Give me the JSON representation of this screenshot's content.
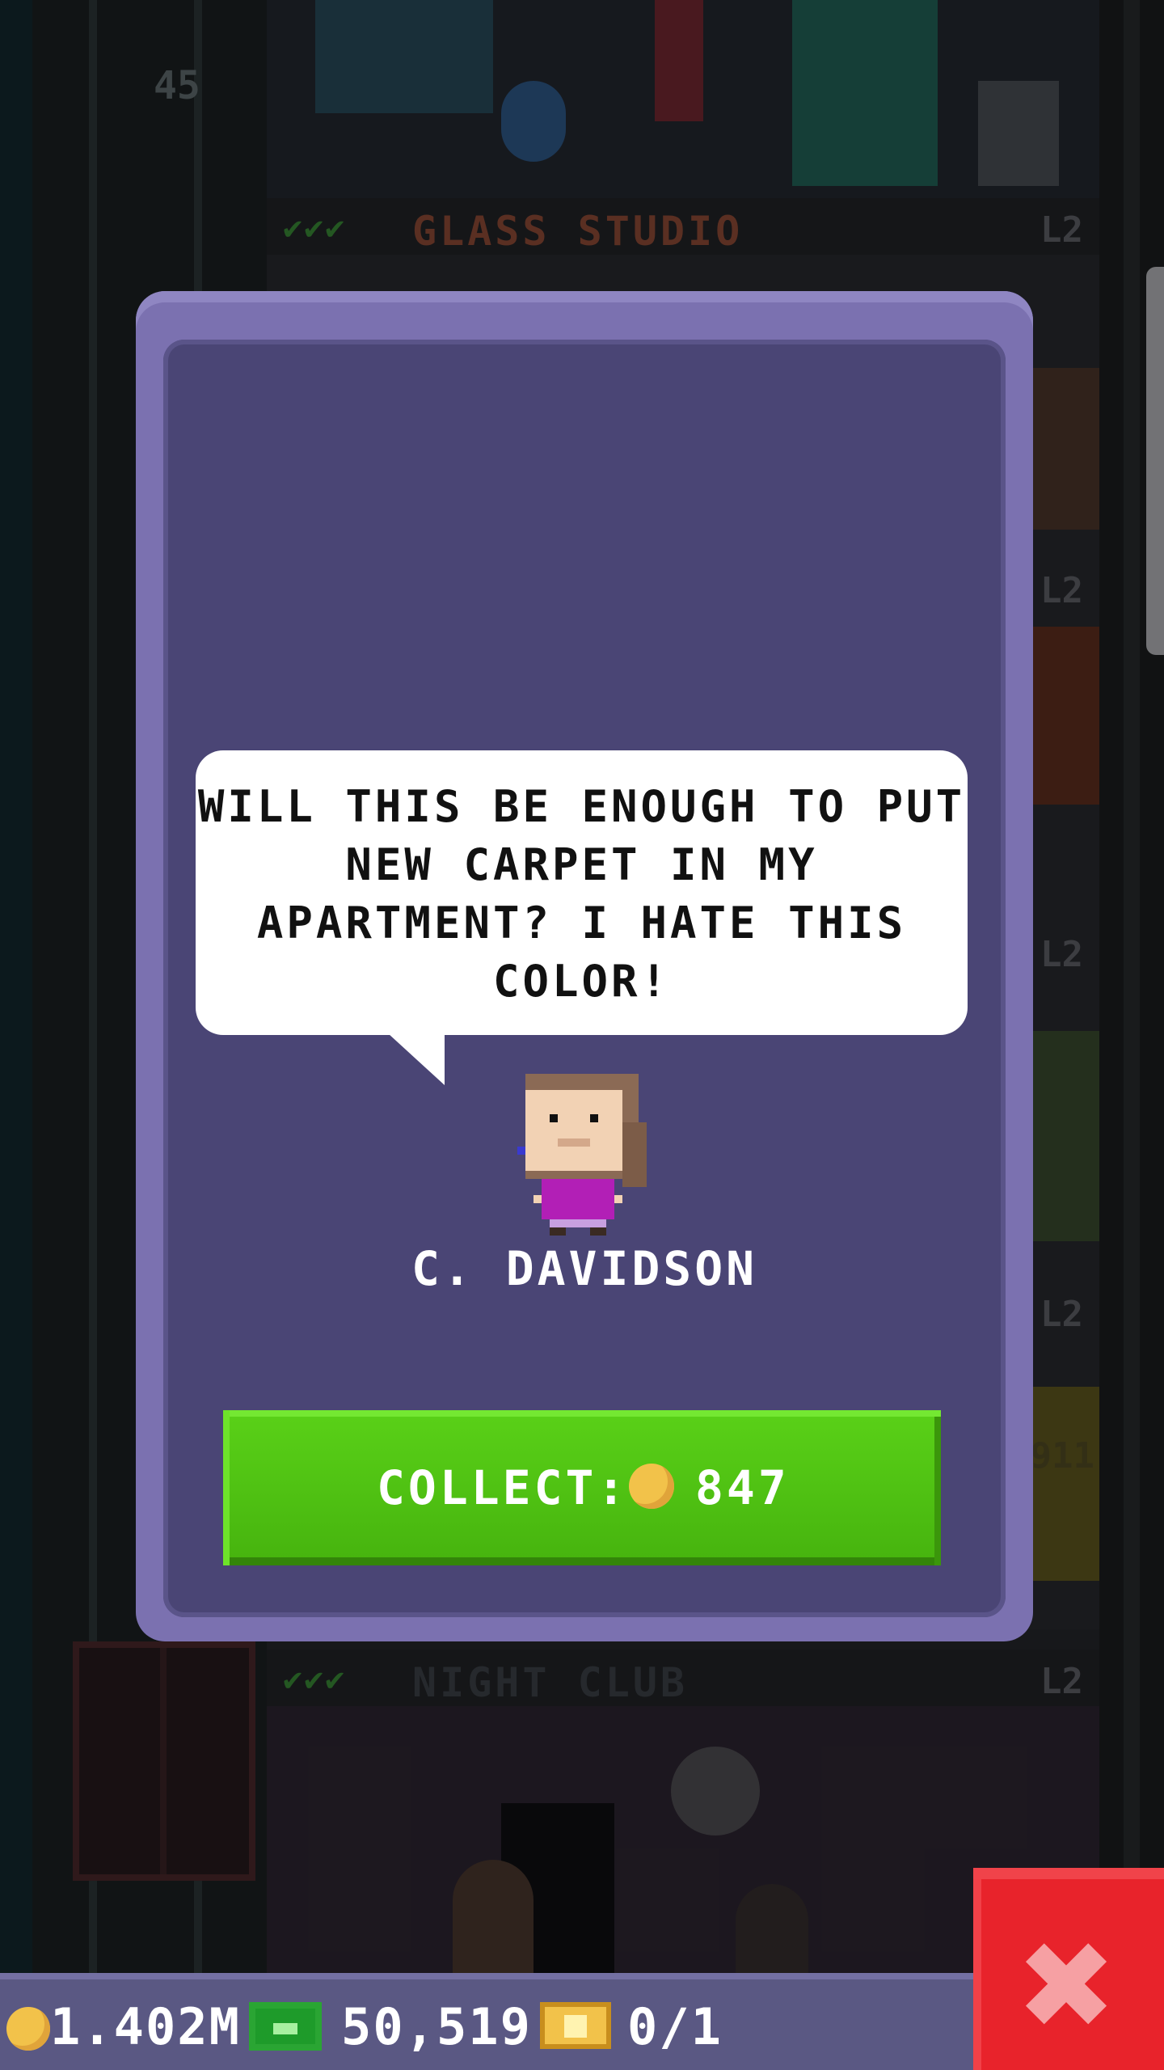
{
  "background": {
    "floor_number": "45",
    "top_floor": {
      "checks": "✔✔✔",
      "name": "GLASS STUDIO",
      "level": "L2"
    },
    "bottom_floor": {
      "checks": "✔✔✔",
      "name": "NIGHT CLUB",
      "level": "L2"
    },
    "side_levels": [
      "L2",
      "L2",
      "L2"
    ],
    "side_sign": "911"
  },
  "dialog": {
    "message": "WILL THIS BE ENOUGH TO PUT NEW CARPET IN MY APARTMENT? I HATE THIS COLOR!",
    "tenant_name": "C. DAVIDSON",
    "collect_label": "COLLECT:",
    "collect_amount": "847"
  },
  "status_bar": {
    "coins": "1.402M",
    "bux": "50,519",
    "tickets": "0/1"
  },
  "close_button": {
    "icon": "close-icon"
  },
  "colors": {
    "dialog_frame": "#7b71b0",
    "dialog_panel": "#4a4575",
    "collect_green": "#4fc212",
    "close_red": "#e8232b",
    "status_bar": "#5a5883"
  }
}
